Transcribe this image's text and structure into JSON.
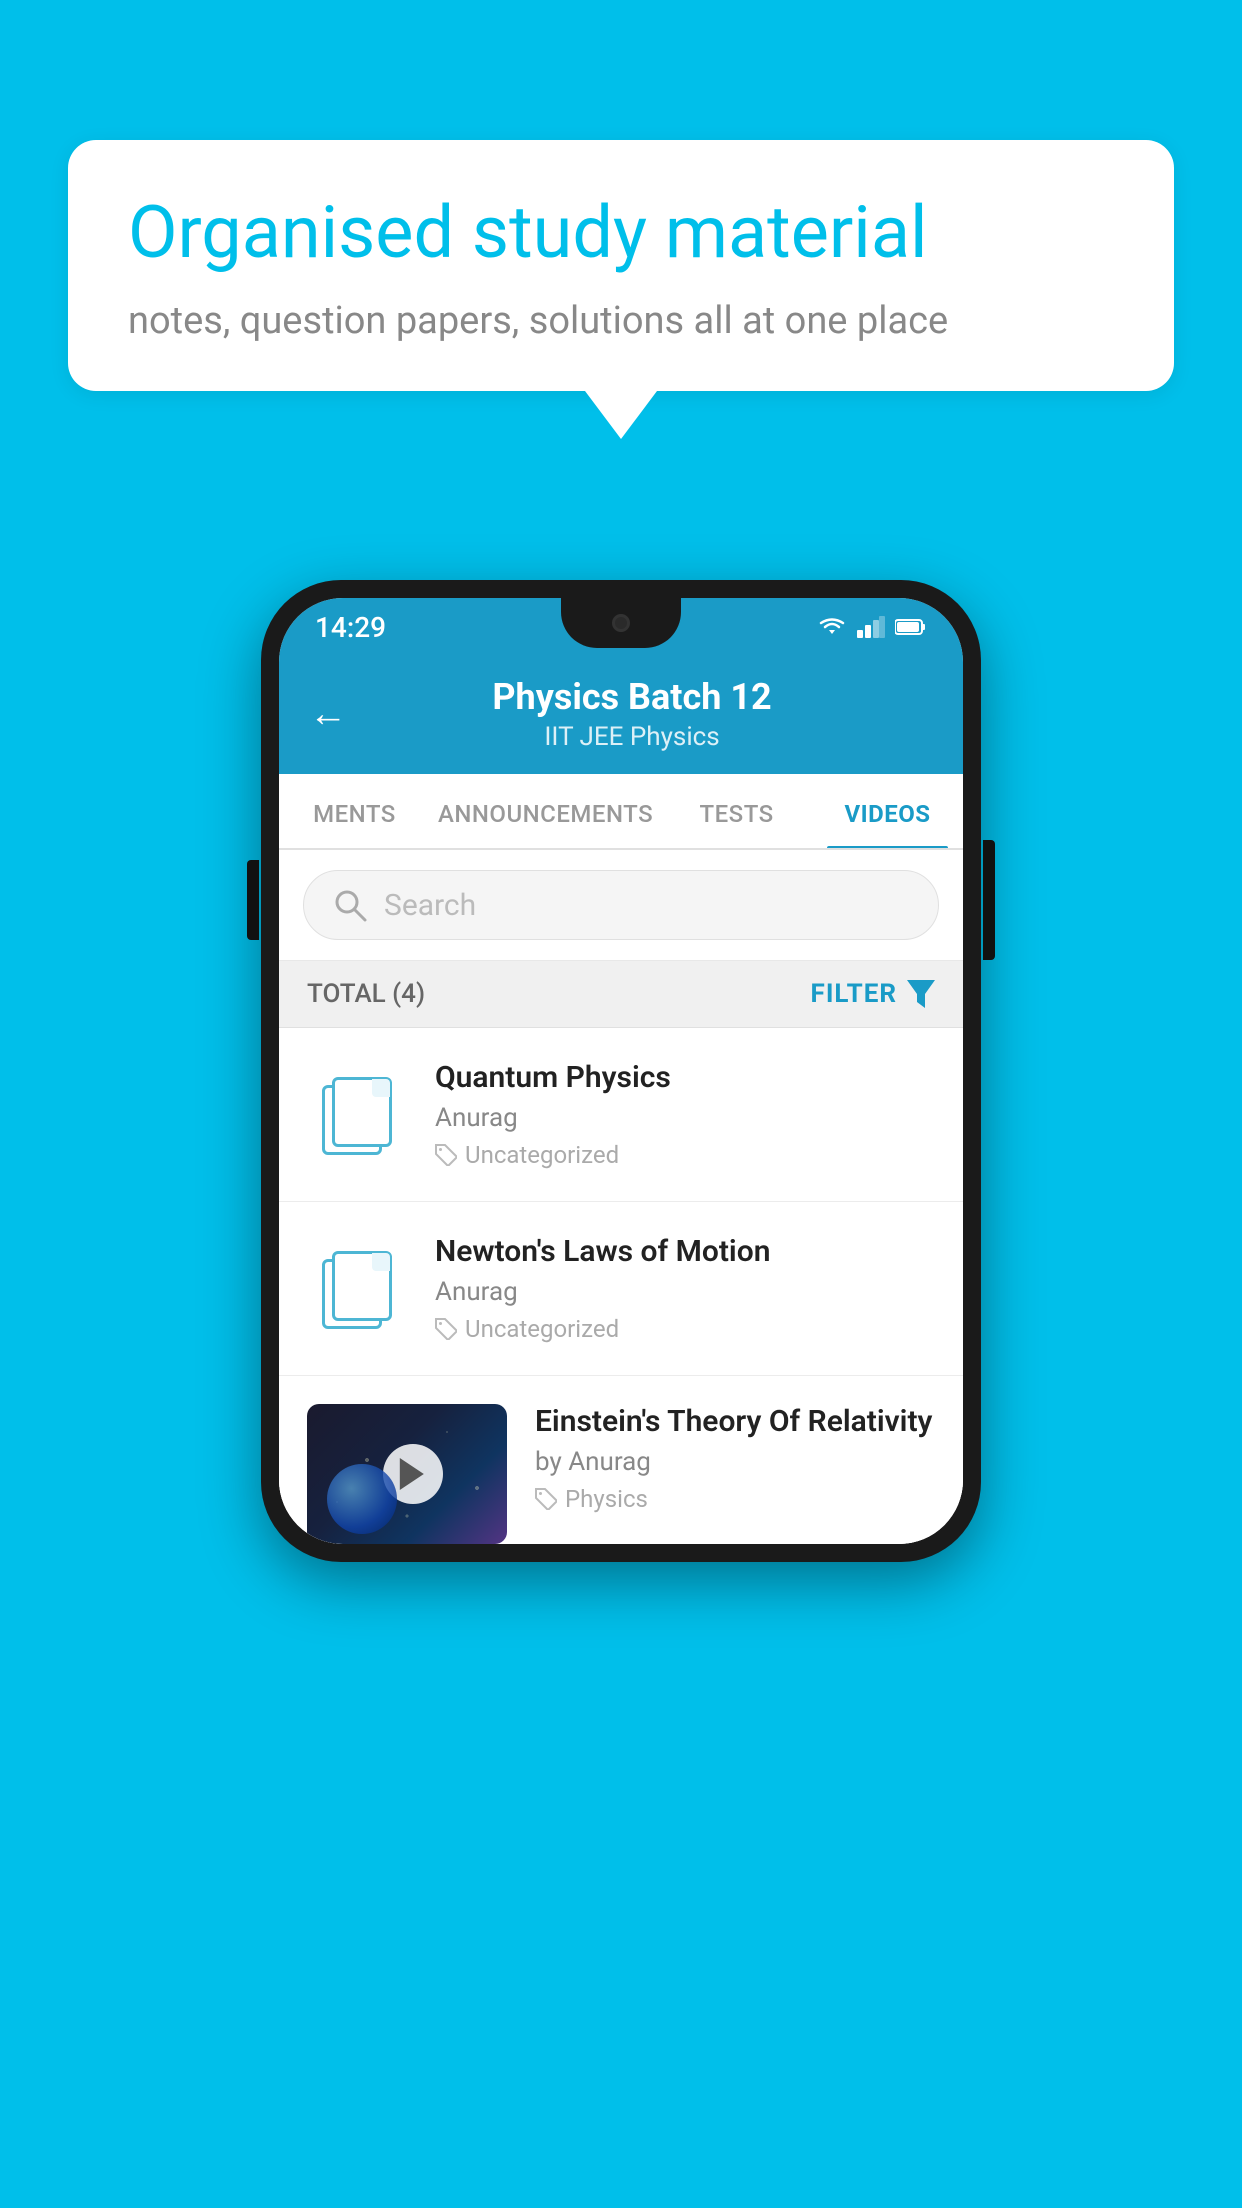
{
  "background": {
    "color": "#00BFEA"
  },
  "speech_bubble": {
    "title": "Organised study material",
    "subtitle": "notes, question papers, solutions all at one place"
  },
  "phone": {
    "status_bar": {
      "time": "14:29",
      "icons": [
        "wifi",
        "signal",
        "battery"
      ]
    },
    "header": {
      "title": "Physics Batch 12",
      "subtitle": "IIT JEE   Physics",
      "back_label": "←"
    },
    "tabs": [
      {
        "label": "MENTS",
        "active": false
      },
      {
        "label": "ANNOUNCEMENTS",
        "active": false
      },
      {
        "label": "TESTS",
        "active": false
      },
      {
        "label": "VIDEOS",
        "active": true
      }
    ],
    "search": {
      "placeholder": "Search"
    },
    "filter_bar": {
      "total_label": "TOTAL (4)",
      "filter_label": "FILTER"
    },
    "videos": [
      {
        "title": "Quantum Physics",
        "author": "Anurag",
        "tag": "Uncategorized",
        "has_thumb": false
      },
      {
        "title": "Newton's Laws of Motion",
        "author": "Anurag",
        "tag": "Uncategorized",
        "has_thumb": false
      },
      {
        "title": "Einstein's Theory Of Relativity",
        "author": "by Anurag",
        "tag": "Physics",
        "has_thumb": true
      }
    ]
  }
}
